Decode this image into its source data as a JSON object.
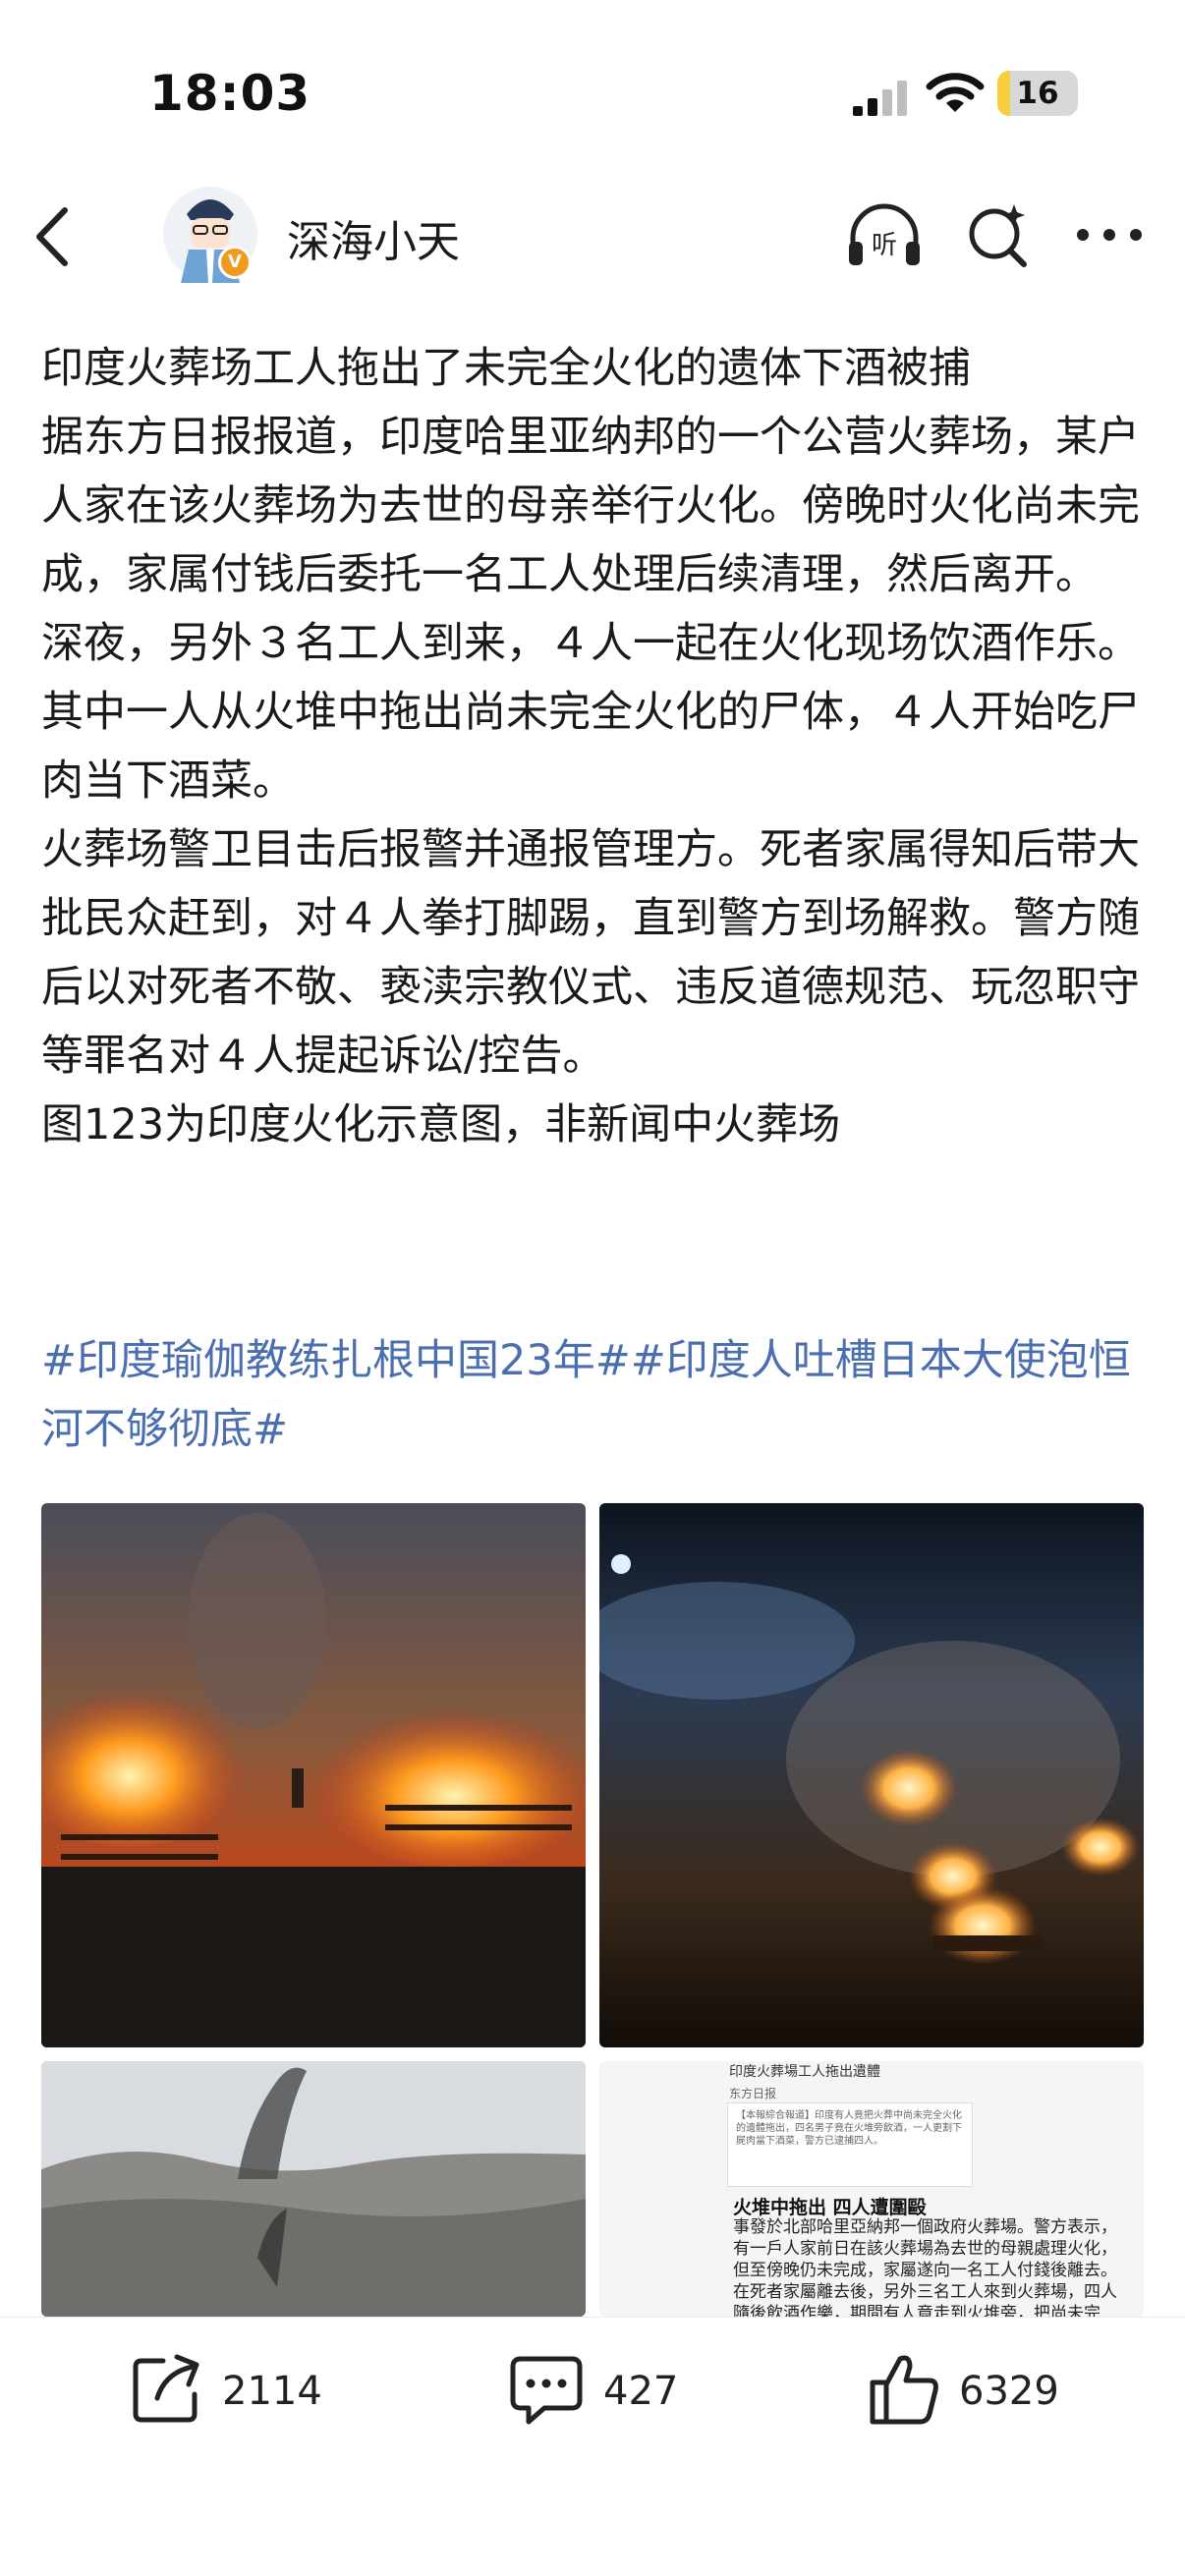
{
  "status": {
    "time": "18:03",
    "battery": "16",
    "battery_level": 0.16
  },
  "header": {
    "author": "深海小天"
  },
  "post": {
    "paragraphs": [
      "印度火葬场工人拖出了未完全火化的遗体下酒被捕",
      "据东方日报报道，印度哈里亚纳邦的一个公营火葬场，某户人家在该火葬场为去世的母亲举行火化。傍晚时火化尚未完成，家属付钱后委托一名工人处理后续清理，然后离开。",
      "深夜，另外３名工人到来，４人一起在火化现场饮酒作乐。其中一人从火堆中拖出尚未完全火化的尸体，４人开始吃尸肉当下酒菜。",
      "火葬场警卫目击后报警并通报管理方。死者家属得知后带大批民众赶到，对４人拳打脚踢，直到警方到场解救。警方随后以对死者不敬、亵渎宗教仪式、违反道德规范、玩忽职守等罪名对４人提起诉讼/控告。",
      "图123为印度火化示意图，非新闻中火葬场"
    ],
    "hashtags": "#印度瑜伽教练扎根中国23年##印度人吐槽日本大使泡恒河不够彻底#"
  },
  "images": {
    "clip": {
      "title": "印度火葬場工人拖出遺體",
      "tag": "东方日报",
      "summary": "【本報綜合報道】印度有人竟把火葬中尚未完全火化的遺體拖出，四名男子竟在火堆旁飲酒，一人更割下屍肉當下酒菜，警方已逮捕四人。",
      "headline": "火堆中拖出 四人遭圍毆",
      "body": "事發於北部哈里亞納邦一個政府火葬場。警方表示，有一戶人家前日在該火葬場為去世的母親處理火化，但至傍晚仍未完成，家屬遂向一名工人付錢後離去。在死者家屬離去後，另外三名工人來到火葬場，四人隨後飲酒作樂，期間有人竟走到火堆旁，把尚未完"
    }
  },
  "actions": {
    "share": "2114",
    "comment": "427",
    "like": "6329"
  },
  "colors": {
    "hashtag": "#4a6eb0",
    "verified": "#f29a1f",
    "battery": "#f7cf3c"
  }
}
